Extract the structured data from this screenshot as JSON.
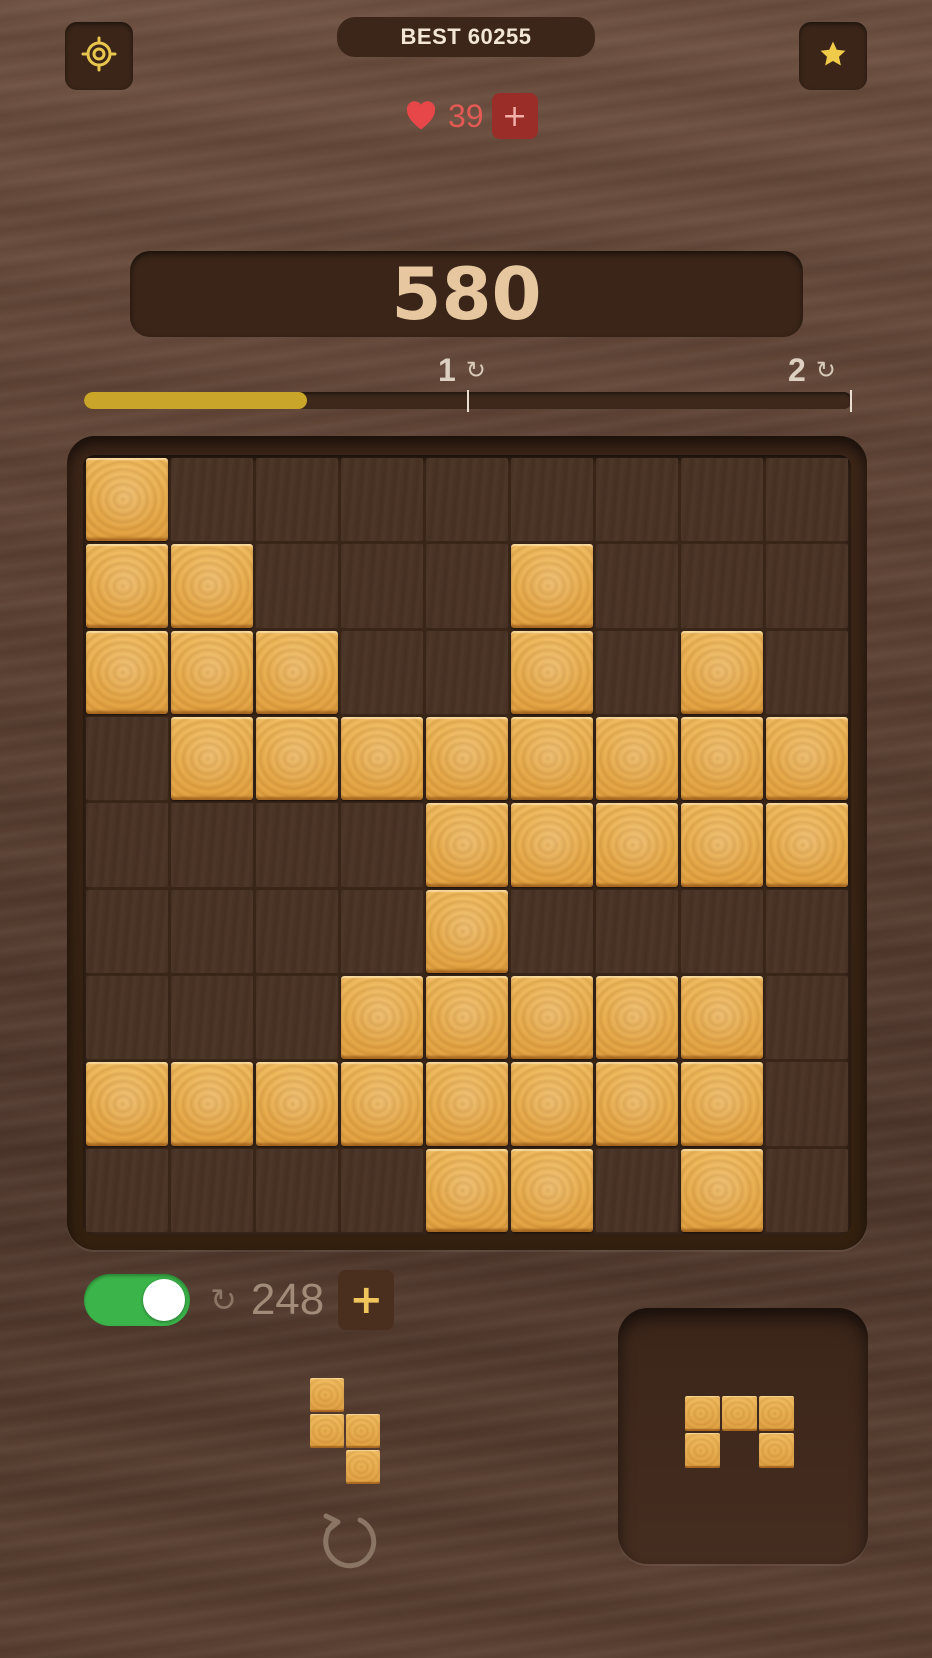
{
  "header": {
    "best_label": "BEST 60255",
    "lives_count": "39",
    "lives_plus": "+",
    "settings_icon": "gear-icon",
    "favorite_icon": "star-icon",
    "heart_icon": "heart-icon"
  },
  "score": "580",
  "progress": {
    "fraction": 0.29,
    "milestones": [
      {
        "label": "1",
        "icon": "refresh-icon"
      },
      {
        "label": "2",
        "icon": "refresh-icon"
      }
    ]
  },
  "board": {
    "cols": 9,
    "rows": 9,
    "grid": [
      [
        1,
        0,
        0,
        0,
        0,
        0,
        0,
        0,
        0
      ],
      [
        1,
        1,
        0,
        0,
        0,
        1,
        0,
        0,
        0
      ],
      [
        1,
        1,
        1,
        0,
        0,
        1,
        0,
        1,
        0
      ],
      [
        0,
        1,
        1,
        1,
        1,
        1,
        1,
        1,
        1
      ],
      [
        0,
        0,
        0,
        0,
        1,
        1,
        1,
        1,
        1
      ],
      [
        0,
        0,
        0,
        0,
        1,
        0,
        0,
        0,
        0
      ],
      [
        0,
        0,
        0,
        1,
        1,
        1,
        1,
        1,
        0
      ],
      [
        1,
        1,
        1,
        1,
        1,
        1,
        1,
        1,
        0
      ],
      [
        0,
        0,
        0,
        0,
        1,
        1,
        0,
        1,
        0
      ]
    ]
  },
  "controls": {
    "auto_rotate_on": true,
    "rotations_count": "248",
    "rotations_plus": "+",
    "rotate_icon": "rotate-icon"
  },
  "pieces": {
    "current": [
      [
        1,
        0
      ],
      [
        1,
        1
      ],
      [
        0,
        1
      ]
    ],
    "held": [
      [
        1,
        1,
        1
      ],
      [
        1,
        0,
        1
      ]
    ]
  },
  "colors": {
    "wood_tile": "#eab04f",
    "accent_gold": "#c9a62a",
    "lives_red": "#e35a55",
    "toggle_green": "#3bb54a"
  }
}
